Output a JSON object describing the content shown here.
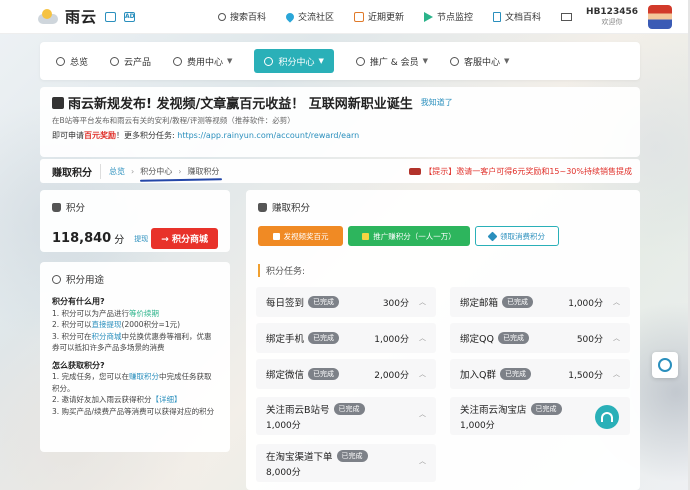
{
  "topbar": {
    "logo": "雨云",
    "nav": [
      {
        "label": "搜索百科",
        "icon": "search-icon"
      },
      {
        "label": "交流社区",
        "icon": "community-icon"
      },
      {
        "label": "近期更新",
        "icon": "calendar-icon"
      },
      {
        "label": "节点监控",
        "icon": "send-icon"
      },
      {
        "label": "文档百科",
        "icon": "document-icon"
      }
    ],
    "user_name": "HB123456",
    "user_sub": "欢迎你"
  },
  "mainnav": {
    "items": [
      {
        "label": "总览"
      },
      {
        "label": "云产品"
      },
      {
        "label": "费用中心"
      },
      {
        "label": "积分中心"
      },
      {
        "label": "推广 & 会员"
      },
      {
        "label": "客服中心"
      }
    ]
  },
  "announce": {
    "title": "雨云新规发布! 发视频/文章赢百元收益！ 互联网新职业诞生",
    "know_link": "我知道了",
    "line2": "在B站等平台发布和雨云有关的安利/教程/评测等视频（推荐软件：必剪）",
    "line3_prefix": "即可申请",
    "line3_red": "百元奖励",
    "line3_mid": "！更多积分任务:",
    "line3_link": "https://app.rainyun.com/account/reward/earn"
  },
  "crumbbar": {
    "title": "赚取积分",
    "crumbs": [
      "总览",
      "积分中心",
      "赚取积分"
    ],
    "tip": "【提示】邀请一客户可得6元奖励和15~30%持续销售提成"
  },
  "points_card": {
    "header": "积分",
    "value": "118,840",
    "unit": "分",
    "withdraw": "提现",
    "shop_button": "积分商城"
  },
  "usage_card": {
    "header": "积分用途",
    "q1": "积分有什么用?",
    "u1a": "1. 积分可以为产品进行",
    "u1b": "等价续期",
    "u2a": "2. 积分可以",
    "u2b": "直接提现",
    "u2c": "(2000积分=1元)",
    "u3a": "3. 积分可在",
    "u3b": "积分商城",
    "u3c": "中兑换优惠券等福利，优惠券可以抵扣许多产品多场景的消费",
    "q2": "怎么获取积分?",
    "g1a": "1. 完成任务，您可以在",
    "g1b": "赚取积分",
    "g1c": "中完成任务获取积分。",
    "g2a": "2. 邀请好友加入雨云获得积分",
    "g2b": "【详细】",
    "g3": "3. 购买产品/续费产品等消费可以获得对应的积分"
  },
  "earn_card": {
    "header": "赚取积分",
    "buttons": [
      "发视频奖百元",
      "推广赚积分（一人一万）",
      "领取消费积分"
    ],
    "tasks_header": "积分任务:",
    "tasks": [
      {
        "name": "每日签到",
        "badge": "已完成",
        "points": "300分"
      },
      {
        "name": "绑定邮箱",
        "badge": "已完成",
        "points": "1,000分"
      },
      {
        "name": "绑定手机",
        "badge": "已完成",
        "points": "1,000分"
      },
      {
        "name": "绑定QQ",
        "badge": "已完成",
        "points": "500分"
      },
      {
        "name": "绑定微信",
        "badge": "已完成",
        "points": "2,000分"
      },
      {
        "name": "加入Q群",
        "badge": "已完成",
        "points": "1,500分"
      },
      {
        "name": "关注雨云B站号",
        "badge": "已完成",
        "points": "1,000分"
      },
      {
        "name": "关注雨云淘宝店",
        "badge": "已完成",
        "points": "1,000分"
      },
      {
        "name": "在淘宝渠道下单",
        "badge": "已完成",
        "points": "8,000分"
      }
    ]
  },
  "colors": {
    "accent": "#2ab0b8",
    "red": "#e8322a",
    "orange": "#f08a24",
    "green": "#2db55d",
    "badge": "#7d8188"
  }
}
